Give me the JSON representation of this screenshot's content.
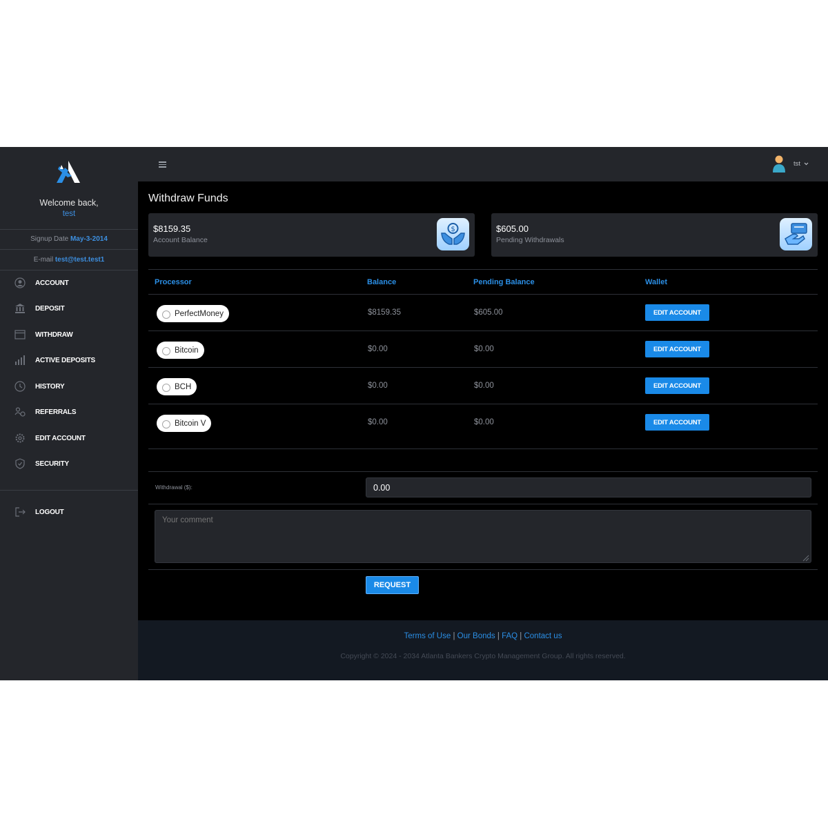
{
  "sidebar": {
    "welcome": "Welcome back,",
    "username": "test",
    "signup_label": "Signup Date",
    "signup_date": "May-3-2014",
    "email_label": "E-mail",
    "email": "test@test.test1",
    "items": [
      {
        "label": "ACCOUNT",
        "icon": "user-circle-icon"
      },
      {
        "label": "DEPOSIT",
        "icon": "bank-icon"
      },
      {
        "label": "WITHDRAW",
        "icon": "wallet-icon"
      },
      {
        "label": "ACTIVE DEPOSITS",
        "icon": "bar-chart-icon"
      },
      {
        "label": "HISTORY",
        "icon": "clock-icon"
      },
      {
        "label": "REFERRALS",
        "icon": "users-icon"
      },
      {
        "label": "EDIT ACCOUNT",
        "icon": "gear-icon"
      },
      {
        "label": "SECURITY",
        "icon": "shield-icon"
      }
    ],
    "logout": "LOGOUT"
  },
  "topbar": {
    "user": "tst"
  },
  "page": {
    "title": "Withdraw Funds",
    "cards": [
      {
        "amount": "$8159.35",
        "caption": "Account Balance",
        "icon": "money-hands-icon"
      },
      {
        "amount": "$605.00",
        "caption": "Pending Withdrawals",
        "icon": "payment-hand-icon"
      }
    ],
    "table": {
      "headers": [
        "Processor",
        "Balance",
        "Pending Balance",
        "Wallet"
      ],
      "rows": [
        {
          "processor": "PerfectMoney",
          "balance": "$8159.35",
          "pending": "$605.00",
          "action": "EDIT ACCOUNT"
        },
        {
          "processor": "Bitcoin",
          "balance": "$0.00",
          "pending": "$0.00",
          "action": "EDIT ACCOUNT"
        },
        {
          "processor": "BCH",
          "balance": "$0.00",
          "pending": "$0.00",
          "action": "EDIT ACCOUNT"
        },
        {
          "processor": "Bitcoin V",
          "balance": "$0.00",
          "pending": "$0.00",
          "action": "EDIT ACCOUNT"
        }
      ]
    },
    "withdrawal_label": "Withdrawal ($):",
    "withdrawal_value": "0.00",
    "comment_placeholder": "Your comment",
    "request_button": "REQUEST"
  },
  "footer": {
    "links": [
      "Terms of Use",
      "Our Bonds",
      "FAQ",
      "Contact us"
    ],
    "separator": "|",
    "copyright": "Copyright © 2024 - 2034 Atlanta Bankers Crypto Management Group. All rights reserved."
  },
  "colors": {
    "accent": "#1a8ae8",
    "link": "#2b8fe6",
    "panel": "#24262b",
    "background": "#000000",
    "footer": "#131922"
  }
}
